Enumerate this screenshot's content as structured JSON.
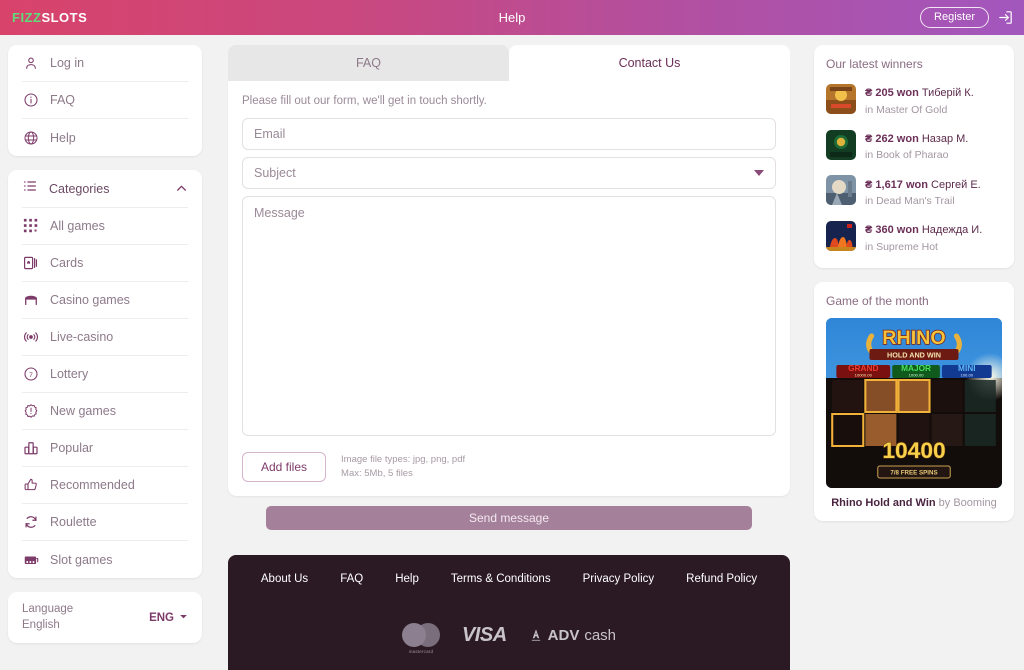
{
  "header": {
    "logo_fizz": "FIZZ",
    "logo_slots": "SLOTS",
    "title": "Help",
    "register_label": "Register",
    "login_icon": "login-arrow-icon"
  },
  "sidebar": {
    "menu": [
      {
        "label": "Log in",
        "icon": "user-icon"
      },
      {
        "label": "FAQ",
        "icon": "info-circle-icon"
      },
      {
        "label": "Help",
        "icon": "globe-icon"
      }
    ],
    "categories_header": {
      "label": "Categories",
      "icon": "list-icon",
      "chevron": "chevron-up-icon"
    },
    "categories": [
      {
        "label": "All games",
        "icon": "grid-dots-icon"
      },
      {
        "label": "Cards",
        "icon": "playing-card-icon"
      },
      {
        "label": "Casino games",
        "icon": "casino-table-icon"
      },
      {
        "label": "Live-casino",
        "icon": "broadcast-icon"
      },
      {
        "label": "Lottery",
        "icon": "lucky-seven-icon"
      },
      {
        "label": "New games",
        "icon": "new-badge-icon"
      },
      {
        "label": "Popular",
        "icon": "bar-chart-icon"
      },
      {
        "label": "Recommended",
        "icon": "thumbs-up-icon"
      },
      {
        "label": "Roulette",
        "icon": "refresh-circle-icon"
      },
      {
        "label": "Slot games",
        "icon": "slot-machine-icon"
      }
    ],
    "language": {
      "label": "Language",
      "value": "English",
      "code": "ENG",
      "chevron": "chevron-down-icon"
    }
  },
  "main": {
    "tabs": [
      {
        "label": "FAQ",
        "active": false
      },
      {
        "label": "Contact Us",
        "active": true
      }
    ],
    "form": {
      "intro": "Please fill out our form, we'll get in touch shortly.",
      "email_placeholder": "Email",
      "email_value": "",
      "subject_placeholder": "Subject",
      "subject_value": "",
      "message_placeholder": "Message",
      "message_value": "",
      "add_files_label": "Add files",
      "files_hint_line1": "Image file types: jpg, png, pdf",
      "files_hint_line2": "Max: 5Mb, 5 files",
      "send_label": "Send message"
    }
  },
  "footer": {
    "links": [
      "About Us",
      "FAQ",
      "Help",
      "Terms & Conditions",
      "Privacy Policy",
      "Refund Policy"
    ],
    "payments": [
      {
        "name": "mastercard",
        "label": "mastercard"
      },
      {
        "name": "visa",
        "label": "VISA"
      },
      {
        "name": "advcash",
        "label_bold": "ADV",
        "label_rest": "cash"
      }
    ]
  },
  "right": {
    "winners_title": "Our latest winners",
    "winners": [
      {
        "amount": "₴ 205 won",
        "name": "Тиберій К.",
        "game": "in Master Of Gold",
        "thumb": "#d59a44"
      },
      {
        "amount": "₴ 262 won",
        "name": "Назар М.",
        "game": "in Book of Pharao",
        "thumb": "#1d4a2e"
      },
      {
        "amount": "₴ 1,617 won",
        "name": "Сергей Е.",
        "game": "in Dead Man's Trail",
        "thumb": "#8d9aa8"
      },
      {
        "amount": "₴ 360 won",
        "name": "Надежда И.",
        "game": "in Supreme Hot",
        "thumb": "#1b2b5c"
      }
    ],
    "gotm_title": "Game of the month",
    "gotm_game": "Rhino Hold and Win",
    "gotm_provider": " by Booming",
    "gotm_art": {
      "title": "RHINO",
      "subtitle": "HOLD AND WIN",
      "jackpots": [
        {
          "name": "GRAND",
          "value": "10000.00"
        },
        {
          "name": "MAJOR",
          "value": "1000.00"
        },
        {
          "name": "MINI",
          "value": "100.00"
        }
      ],
      "win_amount": "10400",
      "free_spins": "7/8  FREE SPINS"
    }
  },
  "colors": {
    "header_gradient_start": "#d8436b",
    "header_gradient_end": "#a257bd",
    "accent": "#7d3b69",
    "send_button": "#a5809a",
    "footer_bg": "#2b1a23",
    "page_bg": "#f2f2f2"
  }
}
